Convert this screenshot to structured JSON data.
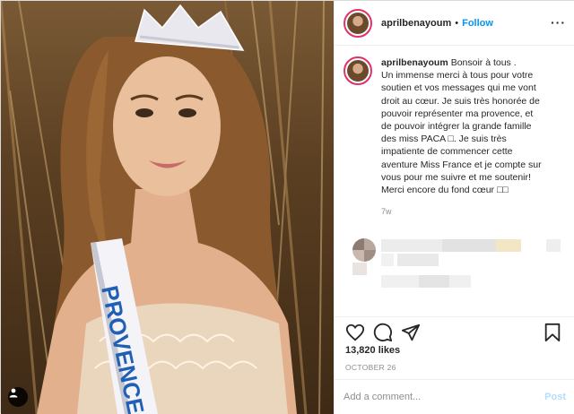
{
  "post": {
    "username": "aprilbenayoum",
    "separator": "•",
    "follow_label": "Follow",
    "more_label": "···",
    "caption_lines": [
      "Bonsoir à tous .",
      "Un immense merci à tous pour votre",
      "soutien et vos messages qui me vont",
      "droit au cœur. Je suis très honorée de",
      "pouvoir représenter ma provence, et",
      "de pouvoir intégrer la grande famille",
      "des miss PACA □. Je suis très",
      "impatiente de commencer cette",
      "aventure Miss France et je compte sur",
      "vous pour me suivre et me soutenir!",
      "Merci encore du fond cœur □□"
    ],
    "age": "7w",
    "likes": "13,820 likes",
    "date": "OCTOBER 26",
    "comment_placeholder": "Add a comment...",
    "post_label": "Post"
  },
  "photo": {
    "sash_text": "PROVENCE",
    "tag_icon": "user-tag-icon"
  },
  "icons": {
    "like": "heart-icon",
    "comment": "comment-icon",
    "share": "share-icon",
    "save": "bookmark-icon"
  },
  "colors": {
    "follow": "#0095f6",
    "post_disabled": "#b2dffc",
    "story_ring": "#e1306c",
    "muted": "#8e8e8e"
  }
}
